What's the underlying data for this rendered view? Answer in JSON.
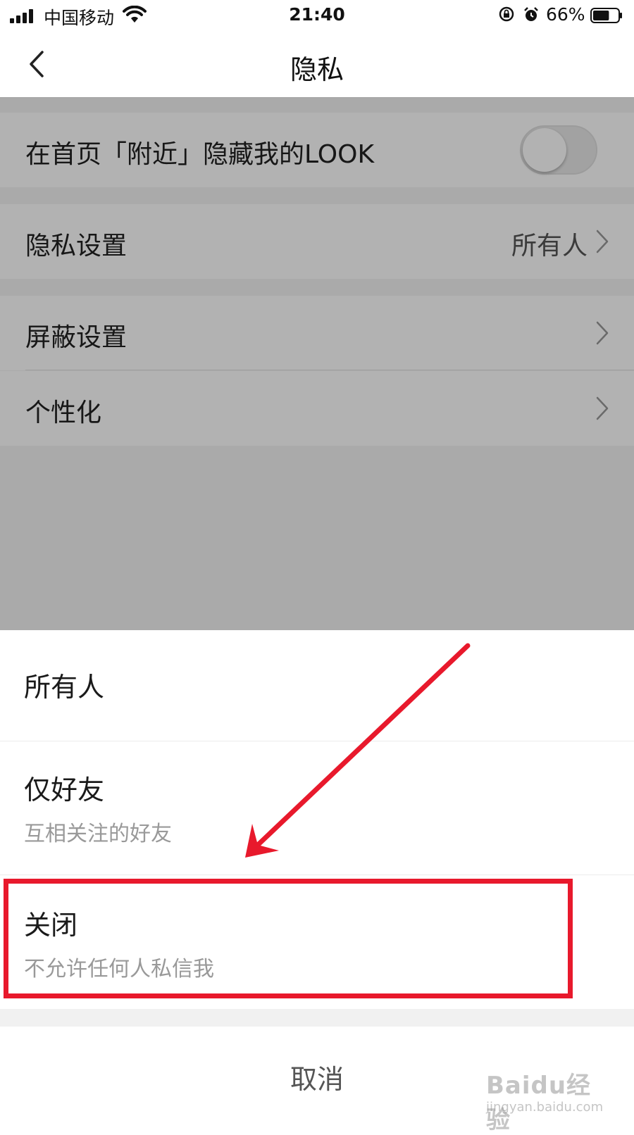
{
  "status_bar": {
    "carrier": "中国移动",
    "time": "21:40",
    "battery": "66%",
    "battery_level": 0.66
  },
  "nav": {
    "title": "隐私",
    "back_icon": "chevron-left-icon"
  },
  "settings": {
    "hide_nearby_label": "在首页「附近」隐藏我的LOOK",
    "hide_nearby_enabled": false,
    "privacy_label": "隐私设置",
    "privacy_value": "所有人",
    "block_label": "屏蔽设置",
    "personalize_label": "个性化"
  },
  "sheet": {
    "options": [
      {
        "title": "所有人",
        "subtitle": ""
      },
      {
        "title": "仅好友",
        "subtitle": "互相关注的好友"
      },
      {
        "title": "关闭",
        "subtitle": "不允许任何人私信我"
      }
    ],
    "cancel_label": "取消"
  },
  "annotation": {
    "color": "#e8192c"
  },
  "watermark": {
    "text": "Baidu经验",
    "url": "jingyan.baidu.com"
  }
}
